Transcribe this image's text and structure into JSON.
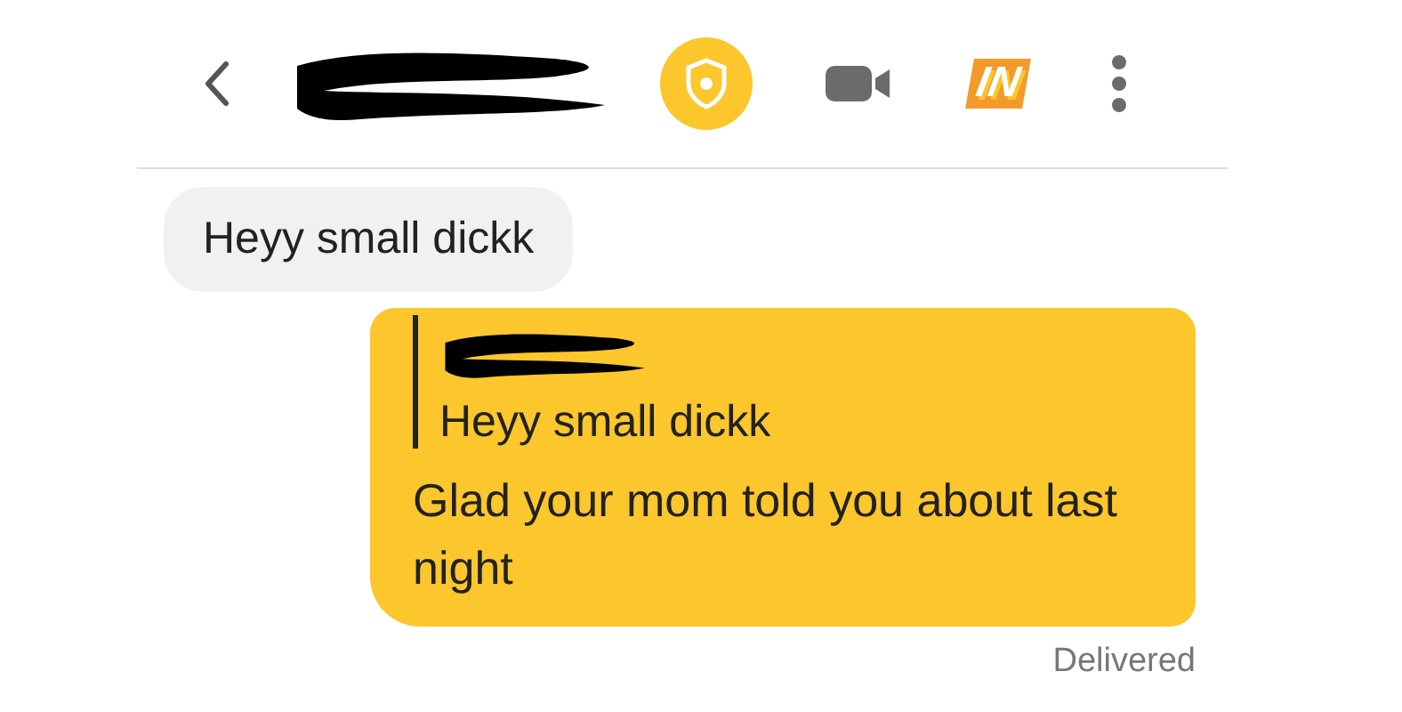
{
  "header": {
    "badge_text": "IN"
  },
  "messages": [
    {
      "kind": "received",
      "text": "Heyy small dickk"
    },
    {
      "kind": "sent",
      "quote": "Heyy small dickk",
      "text": "Glad your mom told you about last night",
      "status": "Delivered"
    }
  ]
}
